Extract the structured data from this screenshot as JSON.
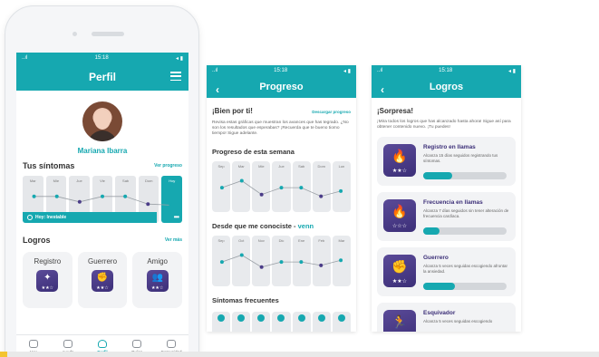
{
  "status": {
    "time": "15:18",
    "signal": "..ıl ",
    "battery": "◂ ▮"
  },
  "perfil": {
    "title": "Perfil",
    "name": "Mariana Ibarra",
    "sintomas_title": "Tus síntomas",
    "sintomas_link": "Ver progreso",
    "days": [
      "Mar",
      "Mie",
      "Jue",
      "Vie",
      "Sab",
      "Dom",
      "Hoy"
    ],
    "today_label": "Hoy: Inestable",
    "more_icon": "•••",
    "logros_title": "Logros",
    "logros_link": "Ver más",
    "logros": [
      {
        "label": "Registro",
        "glyph": "✦",
        "stars": "★★☆"
      },
      {
        "label": "Guerrero",
        "glyph": "✊",
        "stars": "★★☆"
      },
      {
        "label": "Amigo",
        "glyph": "👥",
        "stars": "★★☆"
      }
    ],
    "tabs": [
      "Hoy",
      "Ayuda",
      "Perfil",
      "Guías",
      "Comunidad"
    ],
    "active_tab": 2,
    "chart_week": {
      "levels": [
        0.55,
        0.55,
        0.3,
        0.55,
        0.55,
        0.2,
        0.15
      ],
      "scale": "relative level, 0 = bottom, 1 = top"
    }
  },
  "progreso": {
    "title": "Progreso",
    "greeting": "¡Bien por ti!",
    "download": "Descargar progreso",
    "desc": "Revisa estas gráficas que muestran los avances que has tegrado. ¿No son los resultados que esperabas? ¡Recuerda que te bueno tiomo tiempo! Sigue adelante.",
    "week_title": "Progreso de esta semana",
    "week_days": [
      "Sep",
      "Mar",
      "Mie",
      "Jue",
      "Sab",
      "Dom",
      "Lun"
    ],
    "week_levels": [
      0.55,
      0.75,
      0.35,
      0.55,
      0.55,
      0.3,
      0.45
    ],
    "since_title": "Desde que me conociste - ",
    "since_brand": "venn",
    "since_days": [
      "Sep",
      "Oct",
      "Nov",
      "Dic",
      "Ene",
      "Feb",
      "Mar"
    ],
    "since_levels": [
      0.55,
      0.75,
      0.4,
      0.55,
      0.55,
      0.45,
      0.6
    ],
    "freq_title": "Síntomas frecuentes"
  },
  "logros_screen": {
    "title": "Logros",
    "surprise": "¡Sorpresa!",
    "desc": "¡Mira todos los logros que has alcanzado hasta ahora! Sigue así para obtener contenido nuevo. ¡Tu puedes!",
    "items": [
      {
        "title": "Registro en llamas",
        "desc": "Alcanza 15 días seguidos registrando tus síntomas.",
        "glyph": "🔥",
        "stars": "★★☆",
        "progress": 0.35
      },
      {
        "title": "Frecuencia en llamas",
        "desc": "Alcanza 7 días seguidos sin tener alteración de frecuencia cardíaca.",
        "glyph": "🔥",
        "stars": "☆☆☆",
        "progress": 0.2
      },
      {
        "title": "Guerrero",
        "desc": "Alcanza 5 veces seguidas escogiendo afrontar la ansiedad.",
        "glyph": "✊",
        "stars": "★★☆",
        "progress": 0.38
      },
      {
        "title": "Esquivador",
        "desc": "Alcanza 5 veces seguidas escogiendo",
        "glyph": "🏃",
        "stars": "",
        "progress": 0
      }
    ]
  },
  "colors": {
    "teal": "#16a8b0",
    "purple": "#4a3c88",
    "gray_col": "#e5e7ea"
  }
}
